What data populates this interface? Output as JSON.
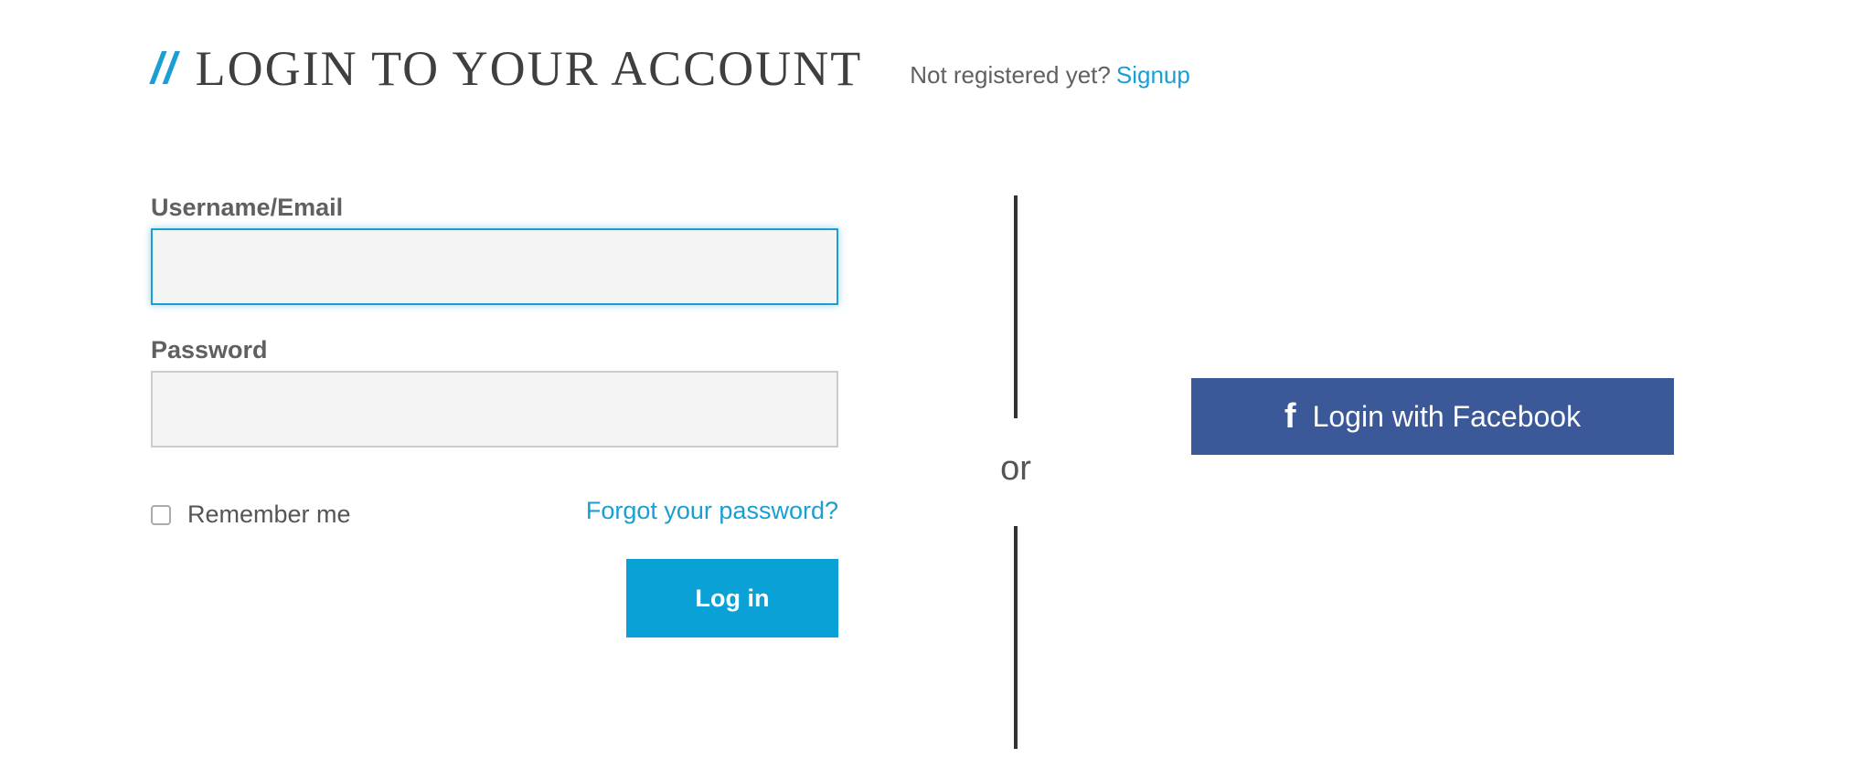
{
  "header": {
    "slashes": "//",
    "title": "LOGIN TO YOUR ACCOUNT",
    "not_registered_text": "Not registered yet?",
    "signup_label": "Signup"
  },
  "form": {
    "username_label": "Username/Email",
    "username_value": "",
    "password_label": "Password",
    "password_value": "",
    "remember_label": "Remember me",
    "remember_checked": false,
    "forgot_label": "Forgot your password?",
    "login_label": "Log in"
  },
  "divider": {
    "or_label": "or"
  },
  "social": {
    "facebook_icon": "facebook-f-icon",
    "facebook_glyph": "f",
    "facebook_label": "Login with Facebook"
  },
  "colors": {
    "accent": "#1a9ed4",
    "login_button": "#09a1d6",
    "facebook": "#3b5998",
    "title_text": "#3f3f3f",
    "input_bg": "#f4f4f4"
  }
}
